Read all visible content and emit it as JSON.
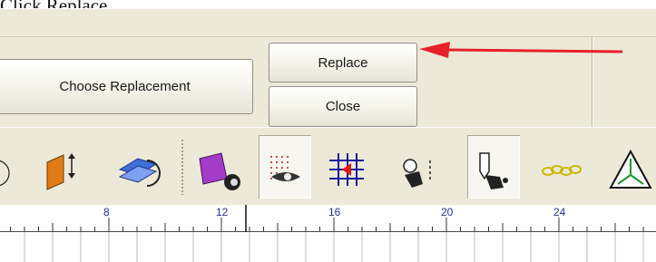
{
  "caption": "Click Replace.",
  "dialog": {
    "choose_replacement_label": "Choose Replacement",
    "replace_label": "Replace",
    "close_label": "Close"
  },
  "toolbar": {
    "tools": [
      {
        "name": "circle-tool-icon"
      },
      {
        "name": "resize-vertical-icon"
      },
      {
        "name": "rotate-shape-icon"
      },
      {
        "name": "purple-box-tool-icon"
      },
      {
        "name": "show-grid-icon"
      },
      {
        "name": "snap-to-grid-icon"
      },
      {
        "name": "node-edit-icon"
      },
      {
        "name": "pen-node-icon"
      },
      {
        "name": "chain-link-icon"
      },
      {
        "name": "triangle-tool-icon"
      }
    ]
  },
  "ruler": {
    "labels": [
      "8",
      "12",
      "16",
      "20",
      "24"
    ]
  },
  "colors": {
    "panel_bg": "#ece9d8",
    "arrow": "#e8202a",
    "ruler_label": "#2a2aa0"
  }
}
